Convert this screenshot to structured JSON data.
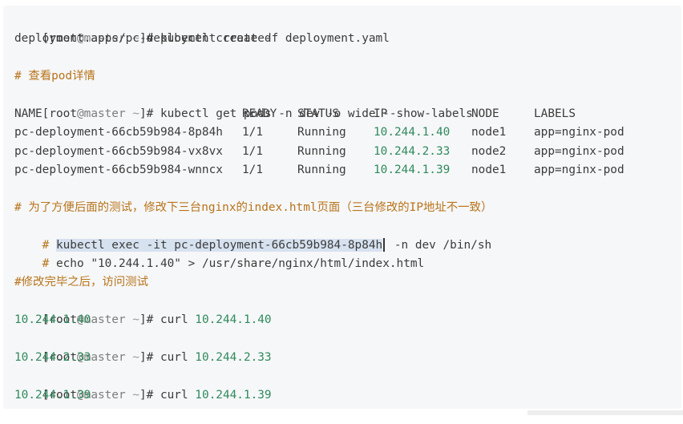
{
  "block1": {
    "prompt_open": "[",
    "prompt_user": "root",
    "prompt_at": "@",
    "prompt_host": "master",
    "prompt_tilde": " ~",
    "prompt_close": "]# ",
    "command": "kubectl create -f deployment.yaml",
    "output": "deployment.apps/pc-deployment created"
  },
  "comment1": "# 查看pod详情",
  "block2": {
    "command": "kubectl get pods -n dev -o wide --show-labels",
    "headers": {
      "name": "NAME",
      "ready": "READY",
      "status": "STATUS",
      "ip": "IP",
      "node": "NODE",
      "labels": "LABELS"
    },
    "rows": [
      {
        "name": "pc-deployment-66cb59b984-8p84h",
        "ready": "1/1",
        "status": "Running",
        "ip": "10.244.1.40",
        "node": "node1",
        "labels": "app=nginx-pod"
      },
      {
        "name": "pc-deployment-66cb59b984-vx8vx",
        "ready": "1/1",
        "status": "Running",
        "ip": "10.244.2.33",
        "node": "node2",
        "labels": "app=nginx-pod"
      },
      {
        "name": "pc-deployment-66cb59b984-wnncx",
        "ready": "1/1",
        "status": "Running",
        "ip": "10.244.1.39",
        "node": "node1",
        "labels": "app=nginx-pod"
      }
    ]
  },
  "comment2": "# 为了方便后面的测试，修改下三台nginx的index.html页面（三台修改的IP地址不一致）",
  "exec_line": {
    "hash": "# ",
    "selected": "kubectl exec -it pc-deployment-66cb59b984-8p84h",
    "rest": " -n dev /bin/sh"
  },
  "echo_line": {
    "hash": "# ",
    "echo": "echo ",
    "quoted": "\"10.244.1.40\"",
    "rest": " > /usr/share/nginx/html/index.html"
  },
  "comment3": "#修改完毕之后，访问测试",
  "curls": [
    {
      "command": "curl ",
      "ip": "10.244.1.40",
      "output": "10.244.1.40"
    },
    {
      "command": "curl ",
      "ip": "10.244.2.33",
      "output": "10.244.2.33"
    },
    {
      "command": "curl ",
      "ip": "10.244.1.39",
      "output": "10.244.1.39"
    }
  ],
  "colors": {
    "background": "#f6f7f9",
    "text": "#3b3b3b",
    "comment": "#b8741a",
    "number": "#2f8a5c",
    "selection": "#d7e2f0"
  }
}
